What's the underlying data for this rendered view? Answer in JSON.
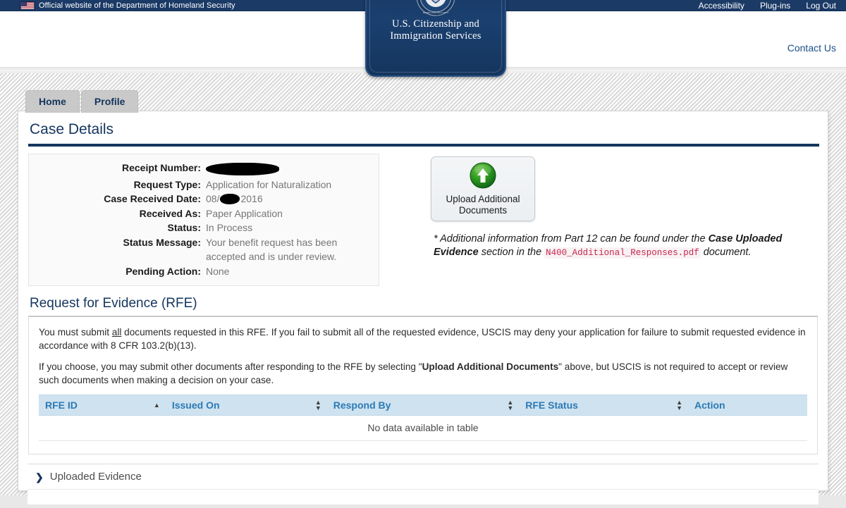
{
  "dhs_banner": {
    "text": "Official website of the Department of Homeland Security",
    "flag_icon": "us-flag-icon"
  },
  "utility_nav": {
    "links": [
      {
        "label": "Accessibility"
      },
      {
        "label": "Plug-ins"
      },
      {
        "label": "Log Out"
      }
    ],
    "contact": "Contact Us"
  },
  "brand": {
    "seal_icon": "dhs-seal-icon",
    "line1": "U.S. Citizenship and",
    "line2": "Immigration Services"
  },
  "tabs": [
    {
      "label": "Home"
    },
    {
      "label": "Profile"
    }
  ],
  "page": {
    "title": "Case Details"
  },
  "case_details": {
    "rows": [
      {
        "label": "Receipt Number:",
        "value": "",
        "redacted": "full"
      },
      {
        "label": "Request Type:",
        "value": "Application for Naturalization"
      },
      {
        "label": "Case Received Date:",
        "value": "08/",
        "value2": "2016",
        "redacted": "partial"
      },
      {
        "label": "Received As:",
        "value": "Paper Application"
      },
      {
        "label": "Status:",
        "value": "In Process"
      },
      {
        "label": "Status Message:",
        "value": "Your benefit request has been accepted and is under review."
      },
      {
        "label": "Pending Action:",
        "value": "None"
      }
    ]
  },
  "upload": {
    "icon": "upload-arrow-icon",
    "label_line1": "Upload Additional",
    "label_line2": "Documents"
  },
  "note": {
    "part1": "* Additional information from Part 12 can be found under the ",
    "bold1": "Case Uploaded Evidence",
    "part2": " section in the ",
    "code": "N400_Additional_Responses.pdf",
    "part3": " document."
  },
  "rfe": {
    "heading": "Request for Evidence (RFE)",
    "paragraph1_a": "You must submit ",
    "paragraph1_underline": "all",
    "paragraph1_b": " documents requested in this RFE. If you fail to submit all of the requested evidence, USCIS may deny your application for failure to submit requested evidence in accordance with 8 CFR 103.2(b)(13).",
    "paragraph2_a": "If you choose, you may submit other documents after responding to the RFE by selecting \"",
    "paragraph2_bold": "Upload Additional Documents",
    "paragraph2_b": "\" above, but USCIS is not required to accept or review such documents when making a decision on your case.",
    "table": {
      "columns": [
        {
          "label": "RFE ID",
          "sort": "asc"
        },
        {
          "label": "Issued On",
          "sort": "none"
        },
        {
          "label": "Respond By",
          "sort": "none"
        },
        {
          "label": "RFE Status",
          "sort": "none"
        },
        {
          "label": "Action",
          "sort": "none"
        }
      ],
      "empty_message": "No data available in table",
      "rows": []
    }
  },
  "uploaded_evidence": {
    "chevron_icon": "chevron-right-icon",
    "label": "Uploaded Evidence"
  },
  "colors": {
    "dhs_bar": "#1b3a66",
    "brand_navy": "#14355d",
    "link_blue": "#1b4f8a",
    "table_header_bg": "#cfe2ef",
    "table_header_text": "#2b7ab5",
    "code_text": "#c7254e",
    "tab_bg": "#c9c9c9"
  }
}
